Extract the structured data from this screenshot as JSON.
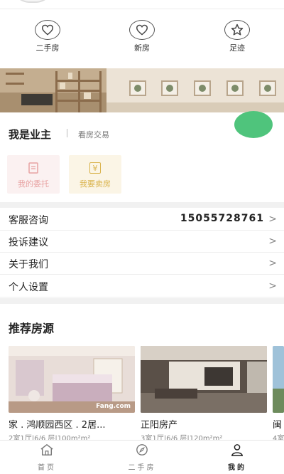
{
  "quick_links": [
    {
      "label": "二手房",
      "icon": "heart-icon"
    },
    {
      "label": "新房",
      "icon": "heart-icon"
    },
    {
      "label": "足迹",
      "icon": "star-icon"
    }
  ],
  "owner": {
    "title": "我是业主",
    "subtitle": "看房交易"
  },
  "owner_cards": [
    {
      "label": "我的委托",
      "icon": "document-icon",
      "color": "#e8a3a3",
      "bg": "#fbf1f1"
    },
    {
      "label": "我要卖房",
      "icon": "yen-icon",
      "color": "#d9b24a",
      "bg": "#fbf5e6"
    }
  ],
  "menu": [
    {
      "label": "客服咨询",
      "value": "15055728761"
    },
    {
      "label": "投诉建议",
      "value": ""
    },
    {
      "label": "关于我们",
      "value": ""
    },
    {
      "label": "个人设置",
      "value": ""
    }
  ],
  "recommend": {
    "title": "推荐房源",
    "listings": [
      {
        "title": "家 . 鸿顺园西区 . 2居...",
        "meta": "2室1厅|6/6 层|100m²m²",
        "watermark": "Fang.com"
      },
      {
        "title": "正阳房产",
        "meta": "3室1厅|6/6 层|120m²m²",
        "watermark": ""
      },
      {
        "title": "闽",
        "meta": "4室",
        "watermark": ""
      }
    ]
  },
  "tabs": [
    {
      "label": "首页",
      "icon": "home-icon"
    },
    {
      "label": "二手房",
      "icon": "compass-icon"
    },
    {
      "label": "我的",
      "icon": "person-icon"
    }
  ],
  "colors": {
    "accent_green": "#4fc47c"
  }
}
